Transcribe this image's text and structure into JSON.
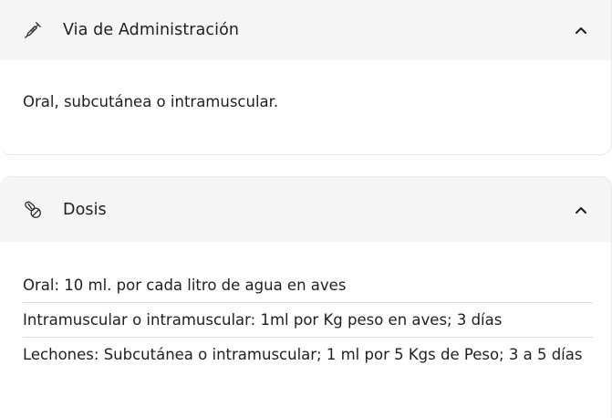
{
  "route": {
    "title": "Via de Administración",
    "icon": "syringe-icon",
    "content": "Oral, subcutánea o intramuscular."
  },
  "dose": {
    "title": "Dosis",
    "icon": "pills-icon",
    "items": [
      "Oral: 10 ml. por cada litro de agua en aves",
      "Intramuscular o intramuscular: 1ml por Kg peso en aves; 3 días",
      "Lechones: Subcutánea o intramuscular; 1 ml por 5 Kgs de Peso; 3 a 5 días"
    ]
  }
}
